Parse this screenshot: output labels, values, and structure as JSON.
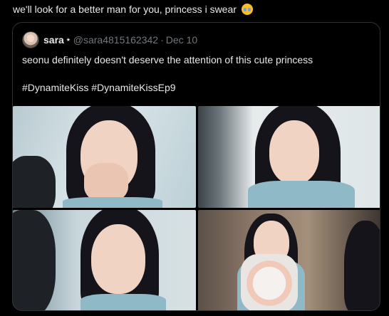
{
  "tweet": {
    "text": "we'll look for a better man for you, princess i swear",
    "emoji": "loudly-crying-face-emoji"
  },
  "quote": {
    "display_name": "sara",
    "badge": "⭑",
    "handle": "@sara4815162342",
    "separator": "·",
    "date": "Dec 10",
    "text": "seonu definitely doesn't deserve the attention of this cute princess",
    "hashtags": "#DynamiteKiss #DynamiteKissEp9",
    "photos": [
      "photo-1",
      "photo-2",
      "photo-3",
      "photo-4"
    ]
  }
}
